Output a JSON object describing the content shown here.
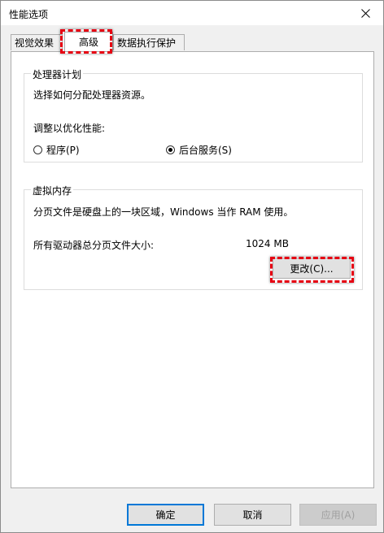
{
  "window": {
    "title": "性能选项"
  },
  "tabs": [
    {
      "label": "视觉效果"
    },
    {
      "label": "高级"
    },
    {
      "label": "数据执行保护"
    }
  ],
  "processor_scheduling": {
    "title": "处理器计划",
    "description": "选择如何分配处理器资源。",
    "adjust_label": "调整以优化性能:",
    "options": [
      {
        "label": "程序(P)",
        "selected": false
      },
      {
        "label": "后台服务(S)",
        "selected": true
      }
    ]
  },
  "virtual_memory": {
    "title": "虚拟内存",
    "description": "分页文件是硬盘上的一块区域，Windows 当作 RAM 使用。",
    "total_label": "所有驱动器总分页文件大小:",
    "total_value": "1024 MB",
    "change_button": "更改(C)..."
  },
  "footer": {
    "ok": "确定",
    "cancel": "取消",
    "apply": "应用(A)"
  },
  "colors": {
    "highlight": "#e60012",
    "accent": "#0078d7"
  }
}
